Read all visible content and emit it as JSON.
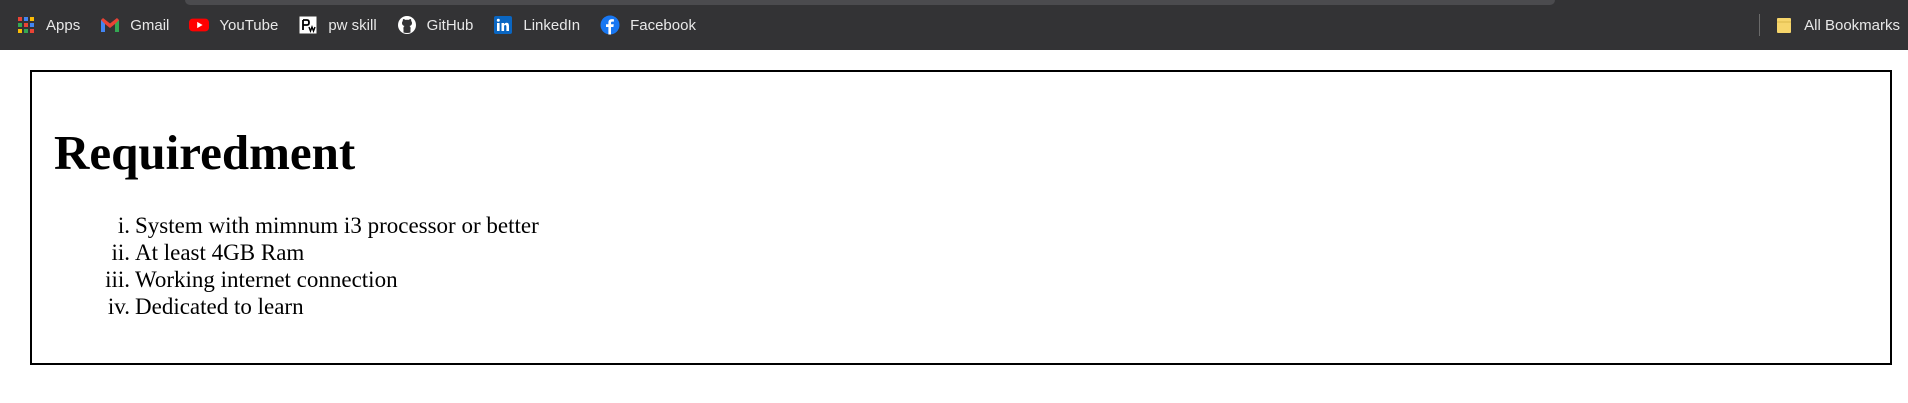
{
  "bookmarks": {
    "items": [
      {
        "label": "Apps",
        "icon": "apps-grid-icon"
      },
      {
        "label": "Gmail",
        "icon": "gmail-icon"
      },
      {
        "label": "YouTube",
        "icon": "youtube-icon"
      },
      {
        "label": "pw skill",
        "icon": "pw-skill-icon"
      },
      {
        "label": "GitHub",
        "icon": "github-icon"
      },
      {
        "label": "LinkedIn",
        "icon": "linkedin-icon"
      },
      {
        "label": "Facebook",
        "icon": "facebook-icon"
      }
    ],
    "all_bookmarks": {
      "label": "All Bookmarks",
      "icon": "folder-icon"
    }
  },
  "page": {
    "title": "Requiredment",
    "list": [
      {
        "num": "i.",
        "text": "System with mimnum i3 processor or better"
      },
      {
        "num": "ii.",
        "text": "At least 4GB Ram"
      },
      {
        "num": "iii.",
        "text": "Working internet connection"
      },
      {
        "num": "iv.",
        "text": "Dedicated to learn"
      }
    ]
  },
  "colors": {
    "bar_background": "#333335",
    "bar_text": "#e8e8e8",
    "page_border": "#000000"
  }
}
